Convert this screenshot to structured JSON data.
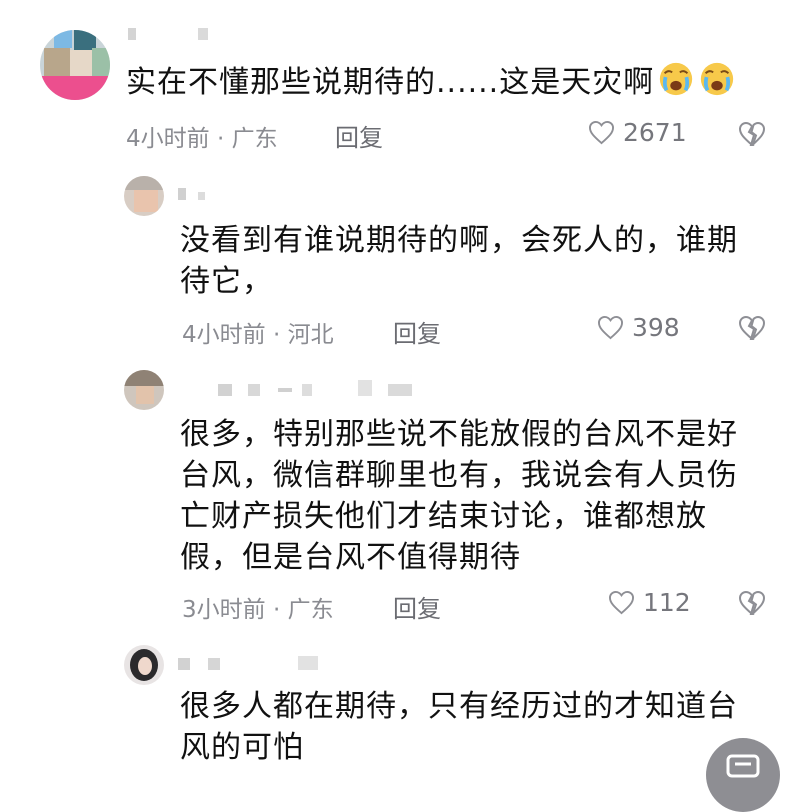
{
  "comments": [
    {
      "text_before": "实在不懂那些说期待的......这是天灾啊",
      "emoji_icon": "crying-face-emoji",
      "time": "4小时前",
      "location": "广东",
      "reply_label": "回复",
      "likes": "2671"
    },
    {
      "text_lines": [
        "没看到有谁说期待的啊，会死人的，谁期",
        "待它，"
      ],
      "time": "4小时前",
      "location": "河北",
      "reply_label": "回复",
      "likes": "398"
    },
    {
      "text_lines": [
        "很多，特别那些说不能放假的台风不是好",
        "台风，微信群聊里也有，我说会有人员伤",
        "亡财产损失他们才结束讨论，谁都想放",
        "假，但是台风不值得期待"
      ],
      "time": "3小时前",
      "location": "广东",
      "reply_label": "回复",
      "likes": "112"
    },
    {
      "text_lines": [
        "很多人都在期待，只有经历过的才知道台",
        "风的可怕"
      ]
    }
  ],
  "colors": {
    "text": "#111111",
    "meta": "#8a8b91",
    "icon": "#8e8f95"
  }
}
